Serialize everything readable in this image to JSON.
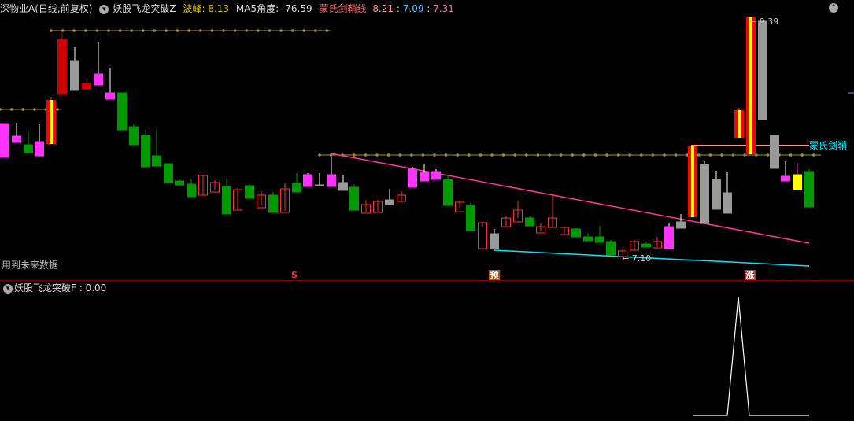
{
  "header": {
    "stock_name": "深物业A(日线,前复权)",
    "indicator_name": "妖股飞龙突破Z",
    "wave_peak_label": "波峰:",
    "wave_peak_value": "8.13",
    "ma5_label": "MA5角度:",
    "ma5_value": "-76.59",
    "sword_label": "蒙氏剑鞘线:",
    "sword_v1": "8.21",
    "sword_v2": "7.09",
    "sword_v3": "7.31",
    "sep": ":"
  },
  "main_chart": {
    "future_data_note": "用到未来数据",
    "high_label": "← 9.39",
    "low_label": "← 7.10",
    "sword_text": "蒙氏剑鞘",
    "signals": [
      {
        "text": "S",
        "color": "#ff3030"
      },
      {
        "text": "预",
        "color": "#ffffff",
        "bg": "#c05000"
      },
      {
        "text": "涨",
        "color": "#ffffff",
        "bg": "#c03030"
      }
    ]
  },
  "sub_chart": {
    "indicator_name": "妖股飞龙突破F",
    "value": "0.00"
  },
  "colors": {
    "pink": "#ff33ff",
    "green": "#009900",
    "red_border": "#ff3030",
    "white": "#ffffff",
    "grey": "#999999",
    "magenta_trend": "#ff3399",
    "cyan_trend": "#00e5ff",
    "olive_dots": "#a09030",
    "sword_line": "#ff9999",
    "yellow": "#ffff00"
  }
}
